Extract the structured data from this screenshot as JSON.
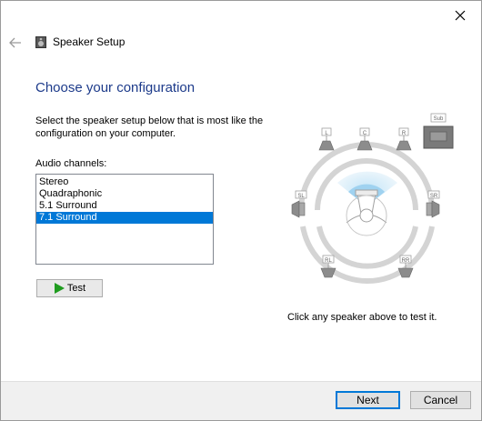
{
  "header": {
    "title": "Speaker Setup"
  },
  "main": {
    "heading": "Choose your configuration",
    "instructions": "Select the speaker setup below that is most like the configuration on your computer.",
    "channels_label": "Audio channels:",
    "channels": [
      "Stereo",
      "Quadraphonic",
      "5.1 Surround",
      "7.1 Surround"
    ],
    "selected_channel": "7.1 Surround",
    "test_label": "Test",
    "hint": "Click any speaker above to test it."
  },
  "speakers": {
    "front_left": "L",
    "center": "C",
    "front_right": "R",
    "subwoofer": "Sub",
    "side_left": "SL",
    "side_right": "SR",
    "rear_left": "RL",
    "rear_right": "RR"
  },
  "footer": {
    "next_label": "Next",
    "cancel_label": "Cancel"
  },
  "colors": {
    "accent": "#0078d7",
    "heading": "#1c3a8a",
    "play": "#1f9c1f"
  }
}
